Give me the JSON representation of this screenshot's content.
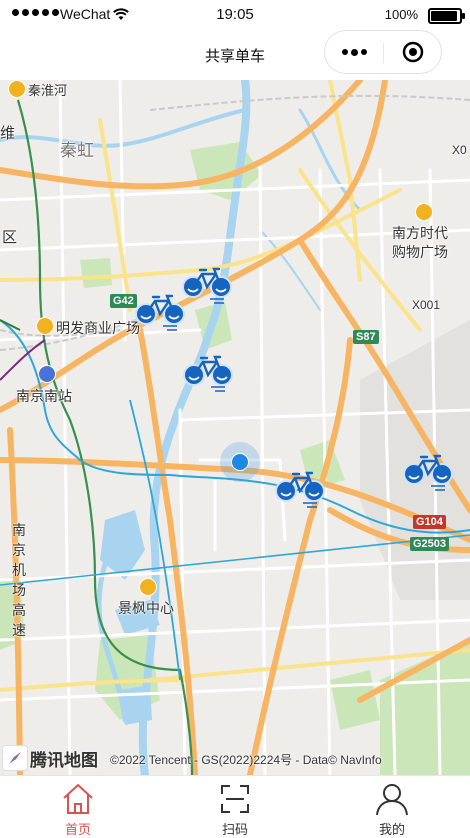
{
  "status_bar": {
    "carrier": "WeChat",
    "time": "19:05",
    "battery": "100%",
    "battery_level": 1.0
  },
  "nav_bar": {
    "title": "共享单车"
  },
  "map": {
    "labels": {
      "qinhuaihe": "秦淮河",
      "qinhong": "秦虹",
      "wei": "维",
      "qu": "区",
      "x0": "X0",
      "nanfang": "南方时代",
      "nanfang2": "购物广场",
      "x001": "X001",
      "mingfa": "明发商业广场",
      "nanjing_south": "南京南站",
      "jingfeng": "景枫中心",
      "airport_road": "南京机场高速",
      "g42": "G42",
      "s87": "S87",
      "g104": "G104",
      "g2503": "G2503"
    },
    "brand": "腾讯地图",
    "copyright": "©2022 Tencent - GS(2022)2224号 - Data© NavInfo"
  },
  "tab_bar": {
    "items": [
      {
        "label": "首页",
        "icon": "home-icon",
        "active": true
      },
      {
        "label": "扫码",
        "icon": "scan-icon",
        "active": false
      },
      {
        "label": "我的",
        "icon": "user-icon",
        "active": false
      }
    ]
  },
  "colors": {
    "accent": "#d9534f",
    "bike_blue": "#1565c0",
    "location_blue": "#1e88e5",
    "road_orange": "#f7b463",
    "road_yellow": "#fbe38c",
    "water": "#a8d4f0",
    "park": "#c7e6b4"
  }
}
